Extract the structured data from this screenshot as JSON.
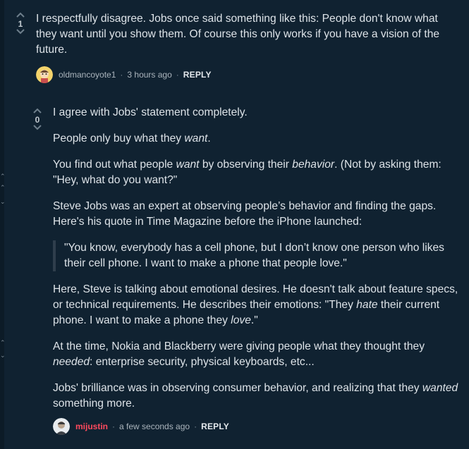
{
  "comments": [
    {
      "score": "1",
      "text": "I respectfully disagree. Jobs once said something like this: People don't know what they want until you show them. Of course this only works if you have a vision of the future.",
      "author": "oldmancoyote1",
      "time": "3 hours ago",
      "reply_label": "REPLY",
      "avatar_icon": "cartoon-face-avatar"
    },
    {
      "score": "0",
      "p1": "I agree with Jobs' statement completely.",
      "p2_a": "People only buy what they ",
      "p2_em": "want",
      "p2_b": ".",
      "p3_a": "You find out what people ",
      "p3_em1": "want",
      "p3_b": " by observing their ",
      "p3_em2": "behavior",
      "p3_c": ". (Not by asking them: \"Hey, what do you want?\"",
      "p4": "Steve Jobs was an expert at observing people’s behavior and finding the gaps. Here's his quote in Time Magazine before the iPhone launched:",
      "quote": "\"You know, everybody has a cell phone, but I don’t know one person who likes their cell phone. I want to make a phone that people love.\"",
      "p5_a": "Here, Steve is talking about emotional desires. He doesn't talk about feature specs, or technical requirements. He describes their emotions: \"They ",
      "p5_em1": "hate",
      "p5_b": " their current phone. I want to make a phone they ",
      "p5_em2": "love",
      "p5_c": ".\"",
      "p6_a": "At the time, Nokia and Blackberry were giving people what they thought they ",
      "p6_em": "needed",
      "p6_b": ": enterprise security, physical keyboards, etc...",
      "p7_a": "Jobs' brilliance was in observing consumer behavior, and realizing that they ",
      "p7_em": "wanted",
      "p7_b": " something more.",
      "author": "mijustin",
      "time": "a few seconds ago",
      "reply_label": "REPLY",
      "avatar_icon": "user-photo-avatar"
    }
  ],
  "colors": {
    "background": "#102231",
    "text": "#dde3e8",
    "self_author": "#ff4a5e"
  }
}
